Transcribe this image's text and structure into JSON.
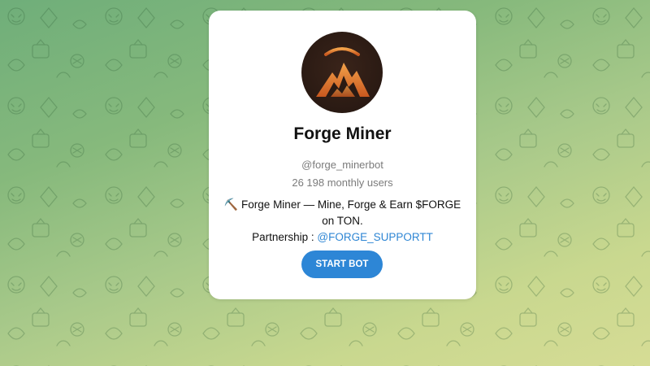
{
  "bot": {
    "name": "Forge Miner",
    "username": "@forge_minerbot",
    "monthly_users": "26 198 monthly users",
    "description_icon": "⛏️",
    "description_line": "Forge Miner — Mine, Forge & Earn $FORGE on TON.",
    "partnership_label": "Partnership :",
    "partnership_link": "@FORGE_SUPPORTT",
    "start_button": "START BOT"
  },
  "colors": {
    "accent": "#2d86d6",
    "link": "#2e86d4",
    "avatar_bg": "#2a1a13",
    "avatar_logo": "#e07a2c"
  },
  "icons": {
    "avatar": "mountain-pickaxe-logo",
    "description": "pickaxe-icon"
  }
}
